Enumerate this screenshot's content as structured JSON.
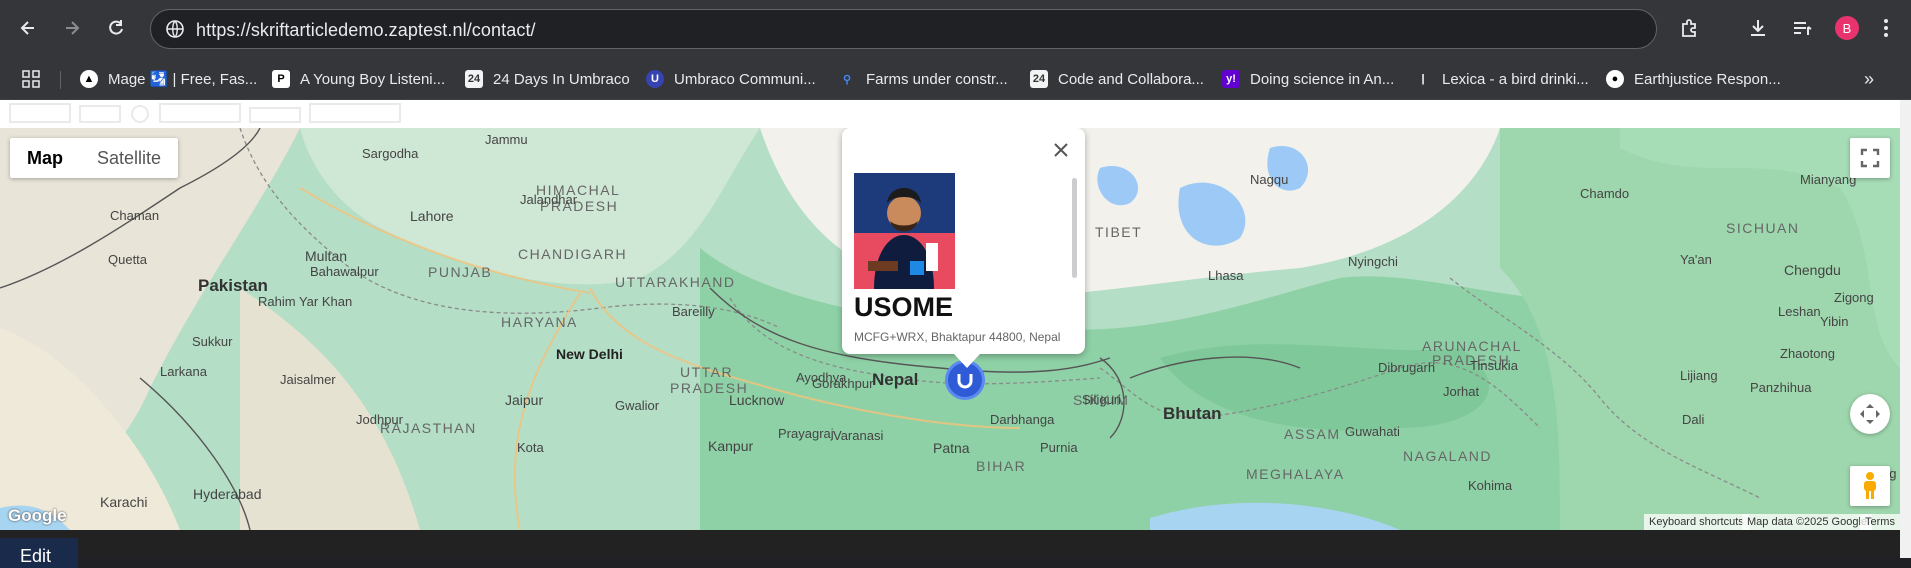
{
  "browser": {
    "url": "https://skriftarticledemo.zaptest.nl/contact/",
    "profile_initial": "B",
    "bookmarks": [
      {
        "label": "Mage 🛂 | Free, Fas..."
      },
      {
        "label": "A Young Boy Listeni..."
      },
      {
        "label": "24 Days In Umbraco"
      },
      {
        "label": "Umbraco Communi..."
      },
      {
        "label": "Farms under constr..."
      },
      {
        "label": "Code and Collabora..."
      },
      {
        "label": "Doing science in An..."
      },
      {
        "label": "Lexica - a bird drinki..."
      },
      {
        "label": "Earthjustice Respon..."
      }
    ]
  },
  "map": {
    "type_map": "Map",
    "type_satellite": "Satellite",
    "labels": {
      "pakistan": "Pakistan",
      "nepal": "Nepal",
      "bhutan": "Bhutan",
      "tibet": "TIBET",
      "sichuan": "SICHUAN",
      "himachal": "HIMACHAL",
      "pradesh1": "PRADESH",
      "punjab": "PUNJAB",
      "chandigarh": "CHANDIGARH",
      "uttarakhand": "UTTARAKHAND",
      "haryana": "HARYANA",
      "uttar": "UTTAR",
      "pradesh2": "PRADESH",
      "rajasthan": "RAJASTHAN",
      "bihar": "BIHAR",
      "sikkim": "SIKKIM",
      "assam": "ASSAM",
      "meghalaya": "MEGHALAYA",
      "nagaland": "NAGALAND",
      "arunachal": "ARUNACHAL",
      "pradesh3": "PRADESH",
      "new_delhi": "New Delhi",
      "lahore": "Lahore",
      "multan": "Multan",
      "jaipur": "Jaipur",
      "lucknow": "Lucknow",
      "kanpur": "Kanpur",
      "patna": "Patna",
      "hyderabad": "Hyderabad",
      "karachi": "Karachi",
      "lhasa": "Lhasa",
      "chengdu": "Chengdu",
      "quetta": "Quetta",
      "jammu": "Jammu",
      "nagqu": "Nagqu",
      "chamdo": "Chamdo",
      "guwahati": "Guwahati",
      "dibrugarh": "Dibrugarh",
      "lijiang": "Lijiang",
      "panzhihua": "Panzhihua",
      "dali": "Dali",
      "zhaotong": "Zhaotong",
      "siliguri": "Siliguri",
      "gorakhpur": "Gorakhpur",
      "varanasi": "Varanasi",
      "prayagraj": "Prayagraj",
      "darbhanga": "Darbhanga",
      "purnia": "Purnia",
      "ayodhya": "Ayodhya",
      "bareilly": "Bareilly",
      "gwalior": "Gwalior",
      "jodhpur": "Jodhpur",
      "jaisalmer": "Jaisalmer",
      "kota": "Kota",
      "sukkur": "Sukkur",
      "larkana": "Larkana",
      "bahawalpur": "Bahawalpur",
      "rahim_yar_khan": "Rahim Yar Khan",
      "sargodha": "Sargodha",
      "jalandhar": "Jalandhar",
      "chaman": "Chaman",
      "nyingchi": "Nyingchi",
      "jorhat": "Jorhat",
      "tinsukia": "Tinsukia",
      "kohima": "Kohima",
      "quijing": "Quijing",
      "leshan": "Leshan",
      "yibin": "Yibin",
      "zigong": "Zigong",
      "mianyang": "Mianyang",
      "yaan": "Ya'an"
    },
    "info_window": {
      "title": "USOME",
      "address": "MCFG+WRX, Bhaktapur 44800, Nepal",
      "close": "✕"
    },
    "attribution": {
      "keyboard": "Keyboard shortcuts",
      "data": "Map data ©2025 Google",
      "terms": "Terms"
    },
    "logo": "Google"
  },
  "page": {
    "edit_label": "Edit"
  }
}
